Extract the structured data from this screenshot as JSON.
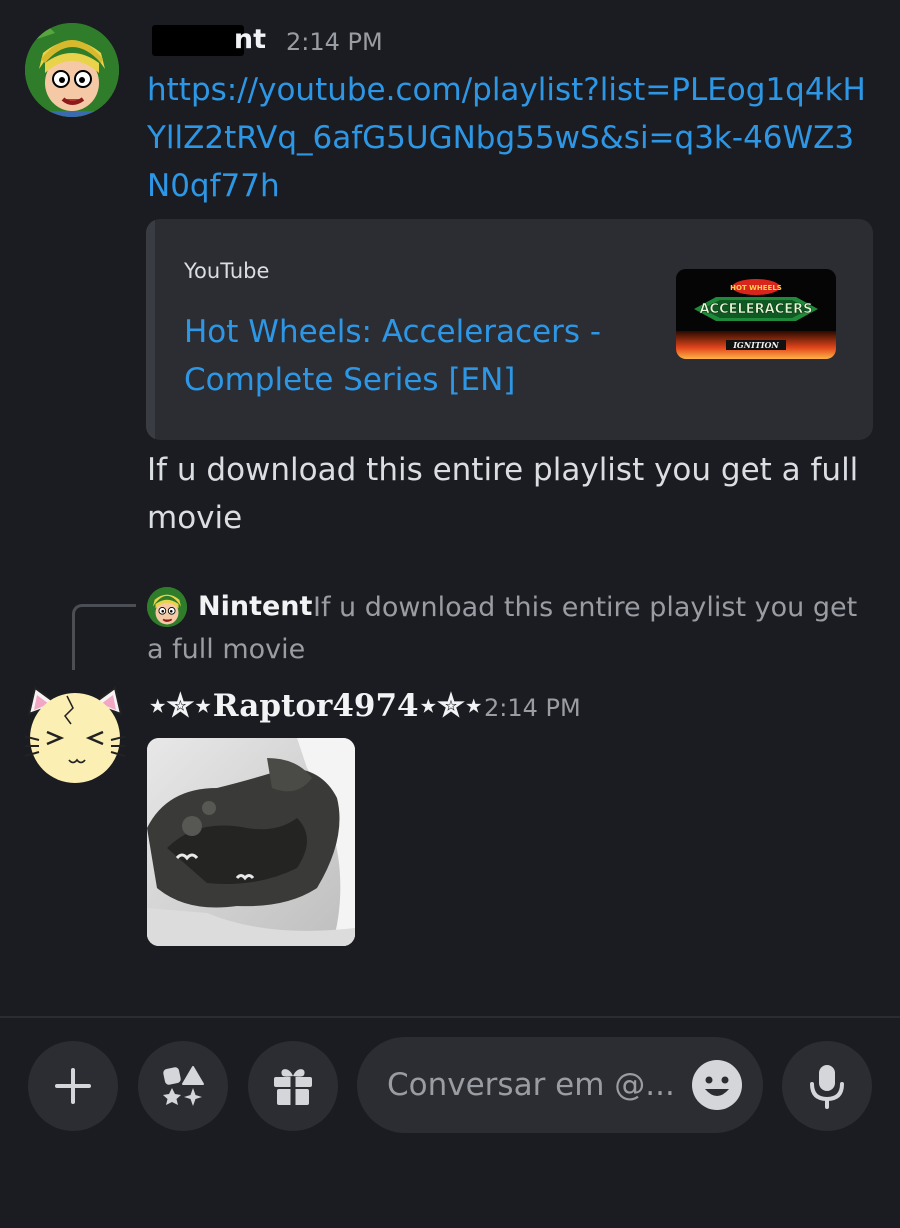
{
  "message1": {
    "author_tail": "nt",
    "timestamp": "2:14 PM",
    "link": "https://youtube.com/playlist?list=PLEog1q4kHYllZ2tRVq_6afG5UGNbg55wS&si=q3k-46WZ3N0qf77h",
    "embed": {
      "provider": "YouTube",
      "title": "Hot Wheels: Acceleracers - Complete Series [EN]",
      "thumbnail_logo": "HOT WHEELS",
      "thumbnail_title": "ACCELERACERS",
      "thumbnail_subtitle": "IGNITION"
    },
    "text": "If u download this entire playlist you get a full movie"
  },
  "reply": {
    "author": "Nintent",
    "text": "If u download this entire playlist you get a full movie"
  },
  "message2": {
    "author": "⋆✮⋆Raptor4974⋆✮⋆",
    "timestamp": "2:14 PM"
  },
  "composer": {
    "placeholder": "Conversar em @..."
  },
  "icons": {
    "plus": "plus-icon",
    "apps": "apps-icon",
    "gift": "gift-icon",
    "emoji": "emoji-icon",
    "mic": "microphone-icon"
  },
  "colors": {
    "background": "#1b1c21",
    "link": "#2d97e6",
    "muted": "#9a9ca3",
    "surface": "#2b2d33"
  }
}
